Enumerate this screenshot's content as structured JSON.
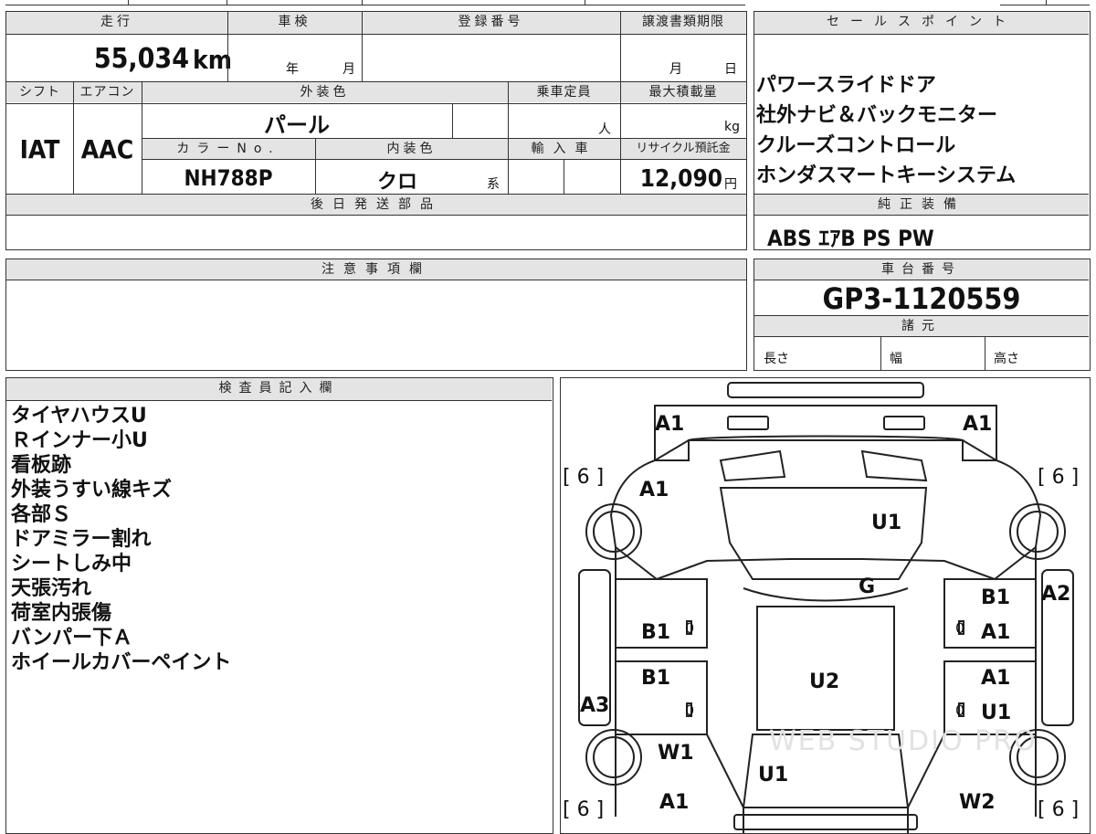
{
  "top_header": {
    "mileage_label": "走行",
    "inspection_label": "車検",
    "registration_label": "登録番号",
    "transfer_deadline_label": "譲渡書類期限",
    "sales_points_label": "セールスポイント"
  },
  "mileage": "55,034",
  "mileage_unit": "km",
  "inspection_year_unit": "年",
  "inspection_month_unit": "月",
  "transfer_month_unit": "月",
  "transfer_day_unit": "日",
  "row2_header": {
    "shift_label": "シフト",
    "aircon_label": "エアコン",
    "exterior_color_label": "外装色",
    "capacity_label": "乗車定員",
    "max_load_label": "最大積載量"
  },
  "shift": "IAT",
  "aircon": "AAC",
  "exterior_color": "パール",
  "capacity_unit": "人",
  "max_load_unit": "kg",
  "row3_header": {
    "color_no_label": "カラーNo.",
    "interior_color_label": "内装色",
    "import_label": "輸入車",
    "recycle_label": "リサイクル預託金"
  },
  "color_no": "NH788P",
  "interior_color": "クロ",
  "interior_suffix": "系",
  "recycle_fee": "12,090",
  "recycle_unit": "円",
  "later_parts_label": "後日発送部品",
  "sales_points": [
    "パワースライドドア",
    "社外ナビ＆バックモニター",
    "クルーズコントロール",
    "ホンダスマートキーシステム"
  ],
  "genuine_equipment_label": "純正装備",
  "genuine_equipment": "ABS ｴｱB PS PW",
  "notes_label": "注意事項欄",
  "chassis_label": "車台番号",
  "chassis_number": "GP3-1120559",
  "specs_label": "諸元",
  "spec_length_label": "長さ",
  "spec_width_label": "幅",
  "spec_height_label": "高さ",
  "inspector_label": "検査員記入欄",
  "inspector_notes": [
    "タイヤハウスU",
    "Ｒインナー小U",
    "看板跡",
    "外装うすい線キズ",
    "各部Ｓ",
    "ドアミラー割れ",
    "シートしみ中",
    "天張汚れ",
    "荷室内張傷",
    "バンパー下Ａ",
    "ホイールカバーペイント"
  ],
  "diagram_marks": {
    "front_left_a1": "A1",
    "front_right_a1": "A1",
    "fender_left_a1": "A1",
    "hood_u1": "U1",
    "windshield_g": "G",
    "tire_fl": "[ 6 ]",
    "tire_fr": "[ 6 ]",
    "tire_rl": "[ 6 ]",
    "tire_rr": "[ 6 ]",
    "right_b1": "B1",
    "right_a2": "A2",
    "left_b1_front": "B1",
    "left_zero_front": "0",
    "right_zero_front": "0",
    "right_a1_front": "A1",
    "left_b1_rear": "B1",
    "roof_u2": "U2",
    "right_a1_rear": "A1",
    "left_a3": "A3",
    "left_zero_rear": "0",
    "right_zero_rear": "0",
    "right_u1_rear": "U1",
    "left_w1": "W1",
    "rear_u1": "U1",
    "rear_left_a1": "A1",
    "rear_right_w2": "W2"
  },
  "watermark": "WEB STUDIO PRO"
}
